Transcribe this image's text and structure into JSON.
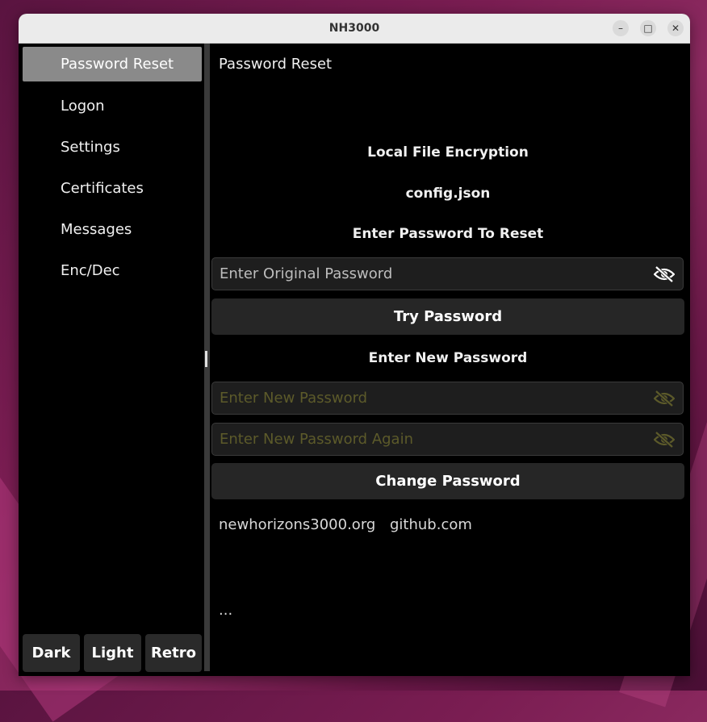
{
  "window": {
    "title": "NH3000"
  },
  "sidebar": {
    "items": [
      {
        "label": "Password Reset",
        "active": true
      },
      {
        "label": "Logon"
      },
      {
        "label": "Settings"
      },
      {
        "label": "Certificates"
      },
      {
        "label": "Messages"
      },
      {
        "label": "Enc/Dec"
      }
    ],
    "themes": [
      "Dark",
      "Light",
      "Retro"
    ]
  },
  "main": {
    "page_title": "Password Reset",
    "section_title": "Local File Encryption",
    "file_name": "config.json",
    "prompt_reset": "Enter Password To Reset",
    "original_password_placeholder": "Enter Original Password",
    "try_button": "Try Password",
    "prompt_new": "Enter New Password",
    "new_password_placeholder": "Enter New Password",
    "new_password_again_placeholder": "Enter New Password Again",
    "change_button": "Change Password",
    "links": [
      "newhorizons3000.org",
      "github.com"
    ],
    "footer_text": "..."
  },
  "colors": {
    "window_bg": "#000000",
    "active_nav": "#8a8a8a",
    "button_bg": "#262626",
    "disabled_placeholder": "#5c5a2a"
  },
  "icons": {
    "visibility": "eye-off-icon"
  }
}
